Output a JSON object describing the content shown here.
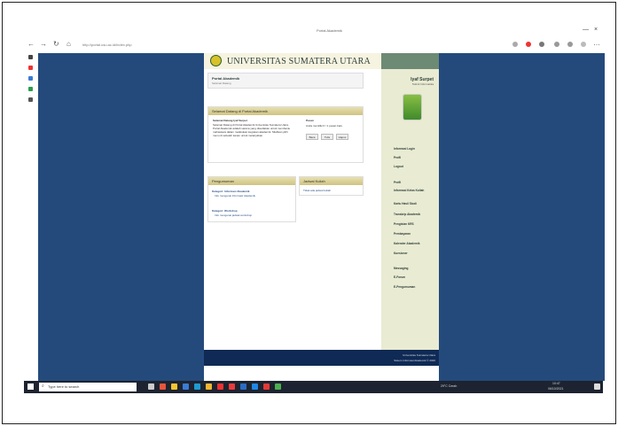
{
  "browser": {
    "tab_title": "Portal Akademik",
    "url": "http://portal.usu.ac.id/index.php",
    "window_controls": [
      "—",
      "×"
    ]
  },
  "site": {
    "university_name": "UNIVERSITAS SUMATERA UTARA",
    "portal_title": "Portal Akademik",
    "portal_subtitle": "Selamat Datang",
    "user": {
      "name": "Iyaf Surpet",
      "sub": "Teknik Informatika"
    },
    "welcome_panel_title": "Selamat Datang di Portal Akademik",
    "welcome_heading": "Selamat Datang Iyaf Surpet",
    "welcome_text": "Selamat Datang di Portal Akademik Universitas Sumatera Utara. Portal Akademik adalah sarana yang disediakan untuk membantu mahasiswa dalam melakukan kegiatan akademik. Silahkan pilih menu di sebelah kanan untuk melanjutkan.",
    "pesan_title": "Pesan",
    "pesan_text": "Anda memiliki 0 / 1 pesan baru",
    "pesan_buttons": [
      "Baca",
      "Tulis",
      "Hapus"
    ],
    "pengumuman_title": "Pengumuman",
    "kategori1_title": "Kategori: Informasi Akademik",
    "kategori1_link": "Info mengenai Informasi Akademik",
    "kategori2_title": "Kategori: Workshop",
    "kategori2_link": "Info mengenai jadwal workshop",
    "jadwal_title": "Jadwal Kuliah",
    "jadwal_text": "Tidak ada jadwal kuliah",
    "menu_group1": [
      "Informasi Login",
      "Profil",
      "Logout"
    ],
    "menu_group2": [
      "Profil",
      "Informasi Kelas Kuliah",
      "Kartu Hasil Studi",
      "Transkrip Akademik",
      "Pengisian KRS",
      "Pembayaran",
      "Kalender Akademik",
      "Kuesioner"
    ],
    "menu_group3": [
      "Messaging",
      "E-Forum",
      "E-Pengumuman"
    ],
    "footer_line1": "Universitas Sumatera Utara",
    "footer_line2": "Sistem Informasi Akademik © 2020"
  },
  "taskbar": {
    "search_placeholder": "Type here to search",
    "weather": "29°C Cerah",
    "time": "10:47",
    "date": "06/10/2021"
  },
  "colors": {
    "page_bg": "#244a7c",
    "header_gold": "#cfc382",
    "footer": "#0f2a54"
  }
}
